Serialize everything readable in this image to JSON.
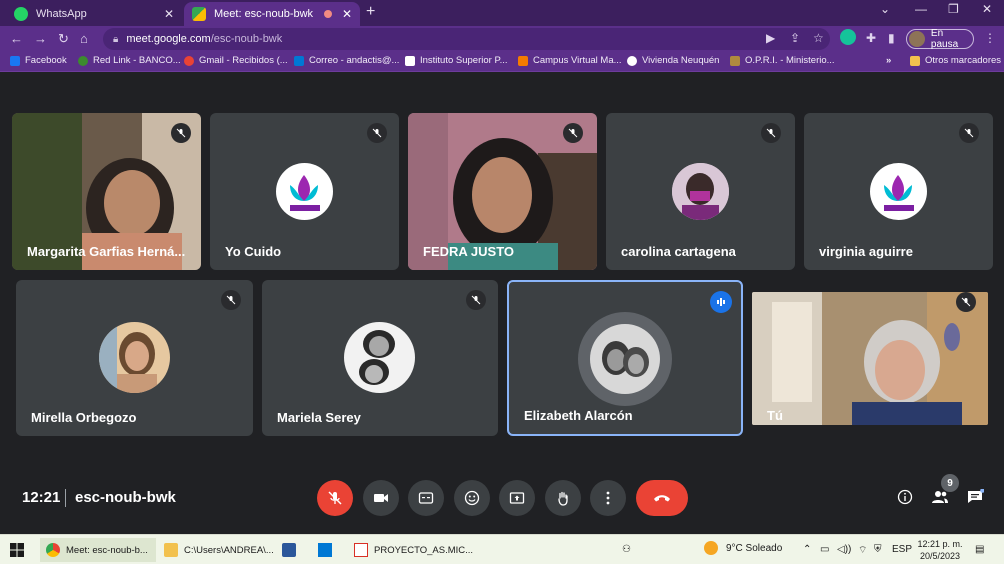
{
  "browser": {
    "tabs": [
      {
        "label": "WhatsApp",
        "icon": "whatsapp-icon"
      },
      {
        "label": "Meet: esc-noub-bwk",
        "icon": "meet-icon"
      }
    ],
    "url": {
      "host": "meet.google.com",
      "path": "/esc-noub-bwk"
    },
    "profile_label": "En pausa",
    "bookmarks": [
      {
        "label": "Facebook",
        "color": "#1877f2"
      },
      {
        "label": "Red Link - BANCO...",
        "color": "#3c8a2e"
      },
      {
        "label": "Gmail - Recibidos (...",
        "color": "#ea4335"
      },
      {
        "label": "Correo - andactis@...",
        "color": "#0078d4"
      },
      {
        "label": "Instituto Superior P...",
        "color": "#ffffff"
      },
      {
        "label": "Campus Virtual Ma...",
        "color": "#f57c00"
      },
      {
        "label": "Vivienda Neuquén",
        "color": "#ffffff"
      },
      {
        "label": "O.P.R.I. - Ministerio...",
        "color": "#b08a3e"
      },
      {
        "label": "Otros marcadores",
        "color": "#f2c14e"
      }
    ]
  },
  "meet": {
    "participants": [
      {
        "name": "Margarita Garfias Herná...",
        "type": "video"
      },
      {
        "name": "Yo Cuido",
        "type": "logo"
      },
      {
        "name": "FEDRA JUSTO",
        "type": "video"
      },
      {
        "name": "carolina cartagena",
        "type": "photo"
      },
      {
        "name": "virginia aguirre",
        "type": "logo"
      },
      {
        "name": "Mirella Orbegozo",
        "type": "photo"
      },
      {
        "name": "Mariela Serey",
        "type": "photo"
      },
      {
        "name": "Elizabeth Alarcón",
        "type": "photo",
        "speaking": true
      },
      {
        "name": "Tú",
        "type": "video"
      }
    ],
    "time": "12:21",
    "meeting_code": "esc-noub-bwk",
    "participants_count": "9",
    "accent": "#8ab4f8",
    "danger": "#ea4335"
  },
  "taskbar": {
    "items": [
      {
        "label": "Meet: esc-noub-b...",
        "icon": "chrome-icon"
      },
      {
        "label": "C:\\Users\\ANDREA\\...",
        "icon": "folder-icon"
      },
      {
        "label": "",
        "icon": "word-icon"
      },
      {
        "label": "",
        "icon": "app-icon"
      },
      {
        "label": "PROYECTO_AS.MIC...",
        "icon": "pdf-icon"
      }
    ],
    "weather": "9°C  Soleado",
    "language": "ESP",
    "time": "12:21 p. m.",
    "date": "20/5/2023"
  }
}
